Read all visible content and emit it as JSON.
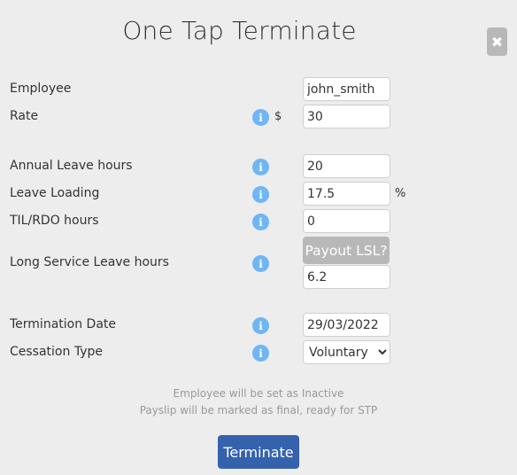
{
  "dialog": {
    "title": "One Tap Terminate",
    "close_icon": "close-icon"
  },
  "fields": {
    "employee": {
      "label": "Employee",
      "value": "john_smith"
    },
    "rate": {
      "label": "Rate",
      "unit": "$",
      "value": "30"
    },
    "annual_leave": {
      "label": "Annual Leave hours",
      "value": "20"
    },
    "leave_loading": {
      "label": "Leave Loading",
      "value": "17.5",
      "unit": "%"
    },
    "til_rdo": {
      "label": "TIL/RDO hours",
      "value": "0"
    },
    "lsl": {
      "label": "Long Service Leave hours",
      "value": "6.2",
      "payout_button": "Payout LSL?"
    },
    "termination_date": {
      "label": "Termination Date",
      "value": "29/03/2022"
    },
    "cessation_type": {
      "label": "Cessation Type",
      "value": "Voluntary",
      "options": [
        "Voluntary"
      ]
    }
  },
  "info_icon": "i",
  "notes": [
    "Employee will be set as Inactive",
    "Payslip will be marked as final, ready for STP"
  ],
  "actions": {
    "terminate_label": "Terminate",
    "close_glyph": "✖"
  },
  "colors": {
    "accent": "#3462ad",
    "info": "#6eb6f5",
    "disabled_button": "#b8b8b8"
  }
}
